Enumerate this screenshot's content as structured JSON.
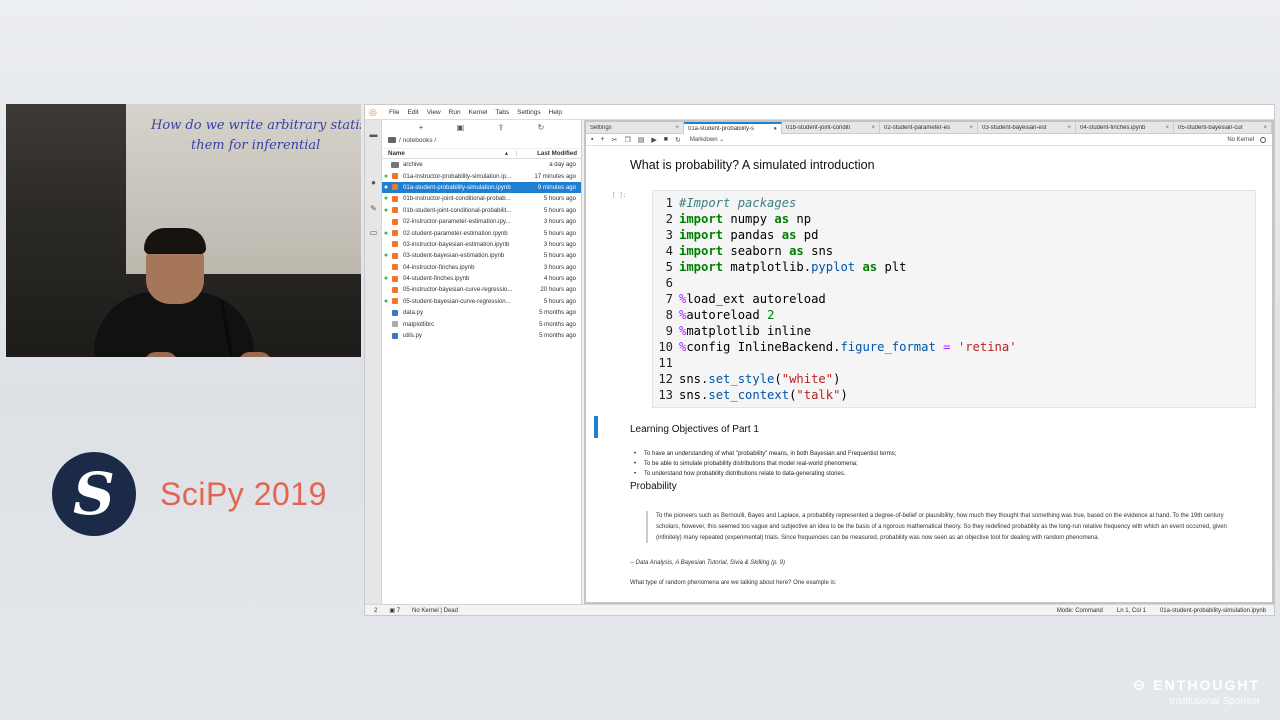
{
  "video": {
    "board_lines": [
      "How do we write arbitrary statis",
      "them for inferential"
    ]
  },
  "conference": {
    "title": "SciPy 2019"
  },
  "sponsor": {
    "brand": "ENTHOUGHT",
    "tag": "Institutional Sponsor"
  },
  "menubar": {
    "items": [
      "File",
      "Edit",
      "View",
      "Run",
      "Kernel",
      "Tabs",
      "Settings",
      "Help"
    ]
  },
  "filebrowser": {
    "toolbar": [
      "+",
      "new-folder-icon",
      "upload-icon",
      "refresh-icon"
    ],
    "path": "/ notebooks /",
    "col_name": "Name",
    "col_modified": "Last Modified",
    "rows": [
      {
        "name": "archive",
        "modified": "a day ago",
        "type": "folder",
        "running": false
      },
      {
        "name": "01a-instructor-probability-simulation.ip...",
        "modified": "17 minutes ago",
        "type": "notebook",
        "running": true
      },
      {
        "name": "01a-student-probability-simulation.ipynb",
        "modified": "9 minutes ago",
        "type": "notebook",
        "running": true,
        "selected": true
      },
      {
        "name": "01b-instructor-joint-conditional-probab...",
        "modified": "5 hours ago",
        "type": "notebook",
        "running": true
      },
      {
        "name": "01b-student-joint-conditional-probabilit...",
        "modified": "5 hours ago",
        "type": "notebook",
        "running": true
      },
      {
        "name": "02-instructor-parameter-estimation.ipy...",
        "modified": "3 hours ago",
        "type": "notebook",
        "running": false
      },
      {
        "name": "02-student-parameter-estimation.ipynb",
        "modified": "5 hours ago",
        "type": "notebook",
        "running": true
      },
      {
        "name": "03-instructor-bayesian-estimation.ipynb",
        "modified": "3 hours ago",
        "type": "notebook",
        "running": false
      },
      {
        "name": "03-student-bayesian-estimation.ipynb",
        "modified": "5 hours ago",
        "type": "notebook",
        "running": true
      },
      {
        "name": "04-instructor-finches.ipynb",
        "modified": "3 hours ago",
        "type": "notebook",
        "running": false
      },
      {
        "name": "04-student-finches.ipynb",
        "modified": "4 hours ago",
        "type": "notebook",
        "running": true
      },
      {
        "name": "05-instructor-bayesian-curve-regressio...",
        "modified": "20 hours ago",
        "type": "notebook",
        "running": false
      },
      {
        "name": "05-student-bayesian-curve-regression...",
        "modified": "5 hours ago",
        "type": "notebook",
        "running": true
      },
      {
        "name": "data.py",
        "modified": "5 months ago",
        "type": "py",
        "running": false
      },
      {
        "name": "matplotlibrc",
        "modified": "5 months ago",
        "type": "txt",
        "running": false
      },
      {
        "name": "utils.py",
        "modified": "5 months ago",
        "type": "py",
        "running": false
      }
    ]
  },
  "tabs": [
    {
      "label": "Settings",
      "close": "×",
      "active": false
    },
    {
      "label": "01a-student-probability-s",
      "close": "●",
      "active": true
    },
    {
      "label": "01b-student-joint-conditi",
      "close": "×",
      "active": false
    },
    {
      "label": "02-student-parameter-es",
      "close": "×",
      "active": false
    },
    {
      "label": "03-student-bayesian-est",
      "close": "×",
      "active": false
    },
    {
      "label": "04-student-finches.ipynb",
      "close": "×",
      "active": false
    },
    {
      "label": "05-student-bayesian-cur",
      "close": "×",
      "active": false
    }
  ],
  "nbtoolbar": {
    "cell_type": "Markdown",
    "kernel": "No Kernel"
  },
  "notebook": {
    "title": "What is probability? A simulated introduction",
    "prompt": "[ ]:",
    "code": [
      {
        "n": "1",
        "tokens": [
          [
            "cm",
            "#Import packages"
          ]
        ]
      },
      {
        "n": "2",
        "tokens": [
          [
            "kw",
            "import"
          ],
          [
            "nm",
            " numpy "
          ],
          [
            "kw",
            "as"
          ],
          [
            "nm",
            " np"
          ]
        ]
      },
      {
        "n": "3",
        "tokens": [
          [
            "kw",
            "import"
          ],
          [
            "nm",
            " pandas "
          ],
          [
            "kw",
            "as"
          ],
          [
            "nm",
            " pd"
          ]
        ]
      },
      {
        "n": "4",
        "tokens": [
          [
            "kw",
            "import"
          ],
          [
            "nm",
            " seaborn "
          ],
          [
            "kw",
            "as"
          ],
          [
            "nm",
            " sns"
          ]
        ]
      },
      {
        "n": "5",
        "tokens": [
          [
            "kw",
            "import"
          ],
          [
            "nm",
            " matplotlib."
          ],
          [
            "at",
            "pyplot"
          ],
          [
            "nm",
            " "
          ],
          [
            "kw",
            "as"
          ],
          [
            "nm",
            " plt"
          ]
        ]
      },
      {
        "n": "6",
        "tokens": []
      },
      {
        "n": "7",
        "tokens": [
          [
            "op",
            "%"
          ],
          [
            "nm",
            "load_ext autoreload"
          ]
        ]
      },
      {
        "n": "8",
        "tokens": [
          [
            "op",
            "%"
          ],
          [
            "nm",
            "autoreload "
          ],
          [
            "num",
            "2"
          ]
        ]
      },
      {
        "n": "9",
        "tokens": [
          [
            "op",
            "%"
          ],
          [
            "nm",
            "matplotlib inline"
          ]
        ]
      },
      {
        "n": "10",
        "tokens": [
          [
            "op",
            "%"
          ],
          [
            "nm",
            "config InlineBackend."
          ],
          [
            "at",
            "figure_format"
          ],
          [
            "nm",
            " "
          ],
          [
            "op",
            "="
          ],
          [
            "nm",
            " "
          ],
          [
            "st",
            "'retina'"
          ]
        ]
      },
      {
        "n": "11",
        "tokens": []
      },
      {
        "n": "12",
        "tokens": [
          [
            "nm",
            "sns."
          ],
          [
            "at",
            "set_style"
          ],
          [
            "nm",
            "("
          ],
          [
            "st",
            "\"white\""
          ],
          [
            "nm",
            ")"
          ]
        ]
      },
      {
        "n": "13",
        "tokens": [
          [
            "nm",
            "sns."
          ],
          [
            "at",
            "set_context"
          ],
          [
            "nm",
            "("
          ],
          [
            "st",
            "\"talk\""
          ],
          [
            "nm",
            ")"
          ]
        ]
      }
    ],
    "objectives_heading": "Learning Objectives of Part 1",
    "objectives": [
      "To have an understanding of what \"probability\" means, in both Bayesian and Frequentist terms;",
      "To be able to simulate probability distributions that model real-world phenomena;",
      "To understand how probability distributions relate to data-generating stories."
    ],
    "probability_heading": "Probability",
    "quote": "To the pioneers such as Bernoulli, Bayes and Laplace, a probability represented a degree-of-belief or plausibility; how much they thought that something was true, based on the evidence at hand. To the 19th century scholars, however, this seemed too vague and subjective an idea to be the basis of a rigorous mathematical theory. So they redefined probability as the long-run relative frequency with which an event occurred, given (infinitely) many repeated (experimental) trials. Since frequencies can be measured, probability was now seen as an objective tool for dealing with random phenomena.",
    "citation": "-- Data Analysis, A Bayesian Tutorial, Sivia & Skilling (p. 9)",
    "paragraph": "What type of random phenomena are we talking about here? One example is:"
  },
  "statusbar": {
    "left_count": "2",
    "terminals": "7",
    "kernel_status": "No Kernel | Dead",
    "mode": "Mode: Command",
    "position": "Ln 1, Col 1",
    "filename": "01a-student-probability-simulation.ipynb"
  },
  "colors": {
    "accent": "#1e7fd3",
    "scipy_red": "#e2664f",
    "jupyter_orange": "#f37626"
  }
}
